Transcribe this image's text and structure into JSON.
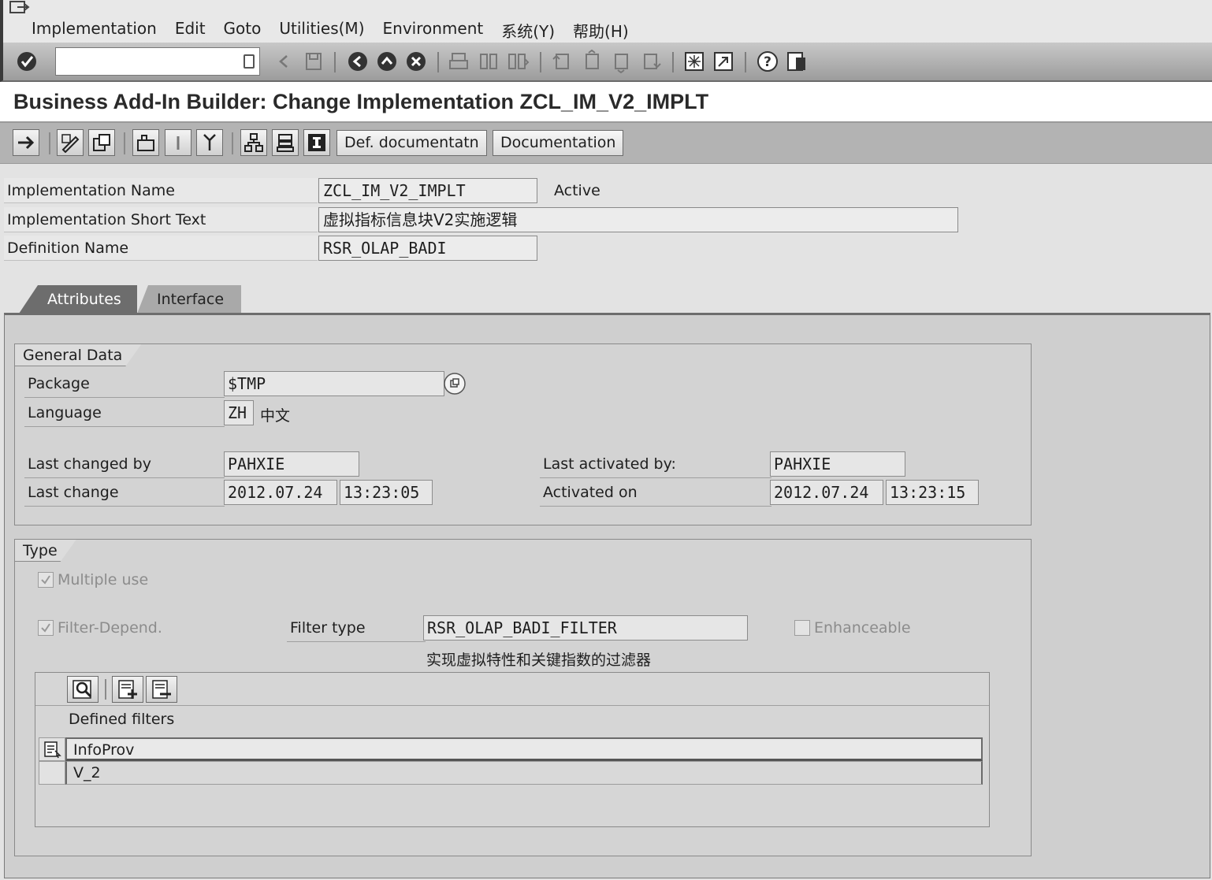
{
  "menu": {
    "items": [
      "Implementation",
      "Edit",
      "Goto",
      "Utilities(M)",
      "Environment",
      "系统(Y)",
      "帮助(H)"
    ]
  },
  "toolbar": {
    "command_value": "",
    "icons": [
      "enter-icon",
      "save-icon",
      "back-icon",
      "exit-icon",
      "cancel-icon",
      "print-icon",
      "find-icon",
      "find-next-icon",
      "first-page-icon",
      "prev-page-icon",
      "next-page-icon",
      "last-page-icon",
      "new-session-icon",
      "shortcut-icon",
      "help-icon",
      "layout-icon"
    ]
  },
  "title": "Business Add-In Builder: Change Implementation ZCL_IM_V2_IMPLT",
  "app_toolbar": {
    "def_doc_label": "Def. documentatn",
    "doc_label": "Documentation"
  },
  "header": {
    "impl_name_label": "Implementation Name",
    "impl_name_value": "ZCL_IM_V2_IMPLT",
    "status": "Active",
    "short_text_label": "Implementation Short Text",
    "short_text_value": "虚拟指标信息块V2实施逻辑",
    "def_name_label": "Definition Name",
    "def_name_value": "RSR_OLAP_BADI"
  },
  "tabs": [
    "Attributes",
    "Interface"
  ],
  "general": {
    "title": "General Data",
    "package_label": "Package",
    "package_value": "$TMP",
    "language_label": "Language",
    "language_code": "ZH",
    "language_name": "中文",
    "last_changed_by_label": "Last changed by",
    "last_changed_by_value": "PAHXIE",
    "last_change_label": "Last change",
    "last_change_date": "2012.07.24",
    "last_change_time": "13:23:05",
    "last_activated_by_label": "Last activated by:",
    "last_activated_by_value": "PAHXIE",
    "activated_on_label": "Activated on",
    "activated_on_date": "2012.07.24",
    "activated_on_time": "13:23:15"
  },
  "type": {
    "title": "Type",
    "multiple_use_label": "Multiple use",
    "multiple_use_checked": true,
    "filter_depend_label": "Filter-Depend.",
    "filter_depend_checked": true,
    "filter_type_label": "Filter type",
    "filter_type_value": "RSR_OLAP_BADI_FILTER",
    "filter_type_desc": "实现虚拟特性和关键指数的过滤器",
    "enhanceable_label": "Enhanceable",
    "enhanceable_checked": false
  },
  "filters": {
    "caption": "Defined filters",
    "column": "InfoProv",
    "rows": [
      "V_2"
    ]
  }
}
